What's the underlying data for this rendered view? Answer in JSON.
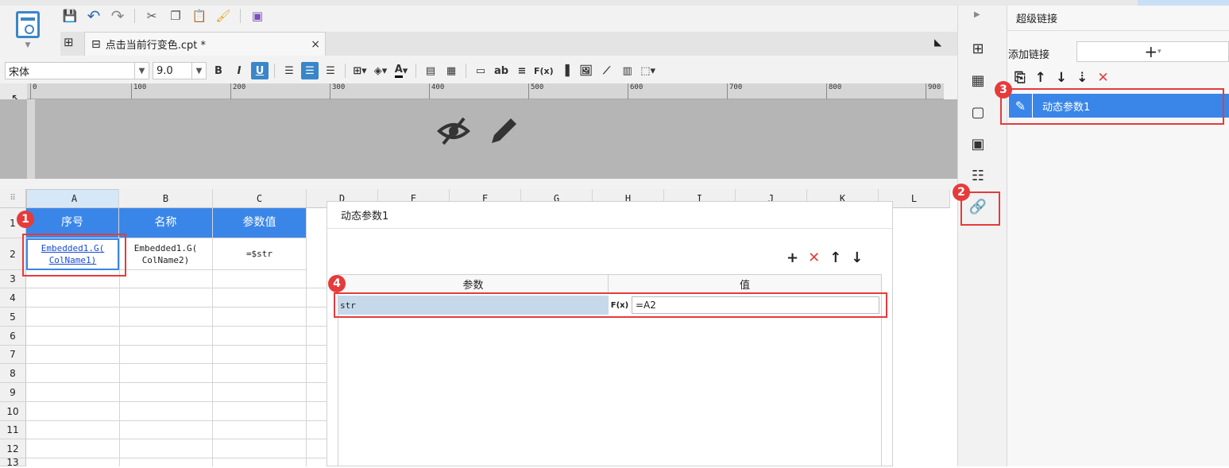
{
  "toolbar": {
    "save": "save-icon",
    "undo": "undo-icon",
    "redo": "redo-icon",
    "cut": "cut-icon",
    "copy": "copy-icon",
    "paste": "paste-icon",
    "brush": "format-painter-icon",
    "template": "template-icon"
  },
  "tab": {
    "name": "点击当前行变色.cpt *",
    "close": "×"
  },
  "format": {
    "font": "宋体",
    "size": "9.0",
    "bold": "B",
    "italic": "I",
    "underline": "U",
    "text_a": "A",
    "ab": "ab",
    "fx": "F(x)"
  },
  "ruler": {
    "ticks": [
      "0",
      "100",
      "200",
      "300",
      "400",
      "500",
      "600",
      "700",
      "800",
      "900"
    ]
  },
  "sheet": {
    "columns": [
      "A",
      "B",
      "C",
      "D",
      "E",
      "F",
      "G",
      "H",
      "I",
      "J",
      "K",
      "L"
    ],
    "rows": [
      "1",
      "2",
      "3",
      "4",
      "5",
      "6",
      "7",
      "8",
      "9",
      "10",
      "11",
      "12",
      "13"
    ],
    "header_row": [
      "序号",
      "名称",
      "参数值"
    ],
    "data_row": {
      "a": "Embedded1.G(\nColName1)",
      "b": "Embedded1.G(\nColName2)",
      "c": "=$str"
    }
  },
  "dialog": {
    "title": "动态参数1",
    "col_param": "参数",
    "col_value": "值",
    "param_name": "str",
    "param_value": "=A2",
    "fx": "F(x)"
  },
  "right_panel": {
    "title": "超级链接",
    "add_label": "添加链接",
    "add_button": "+",
    "item": "动态参数1"
  },
  "badges": [
    "1",
    "2",
    "3",
    "4"
  ],
  "colors": {
    "accent": "#3a86e8",
    "highlight": "#e63b3b",
    "param_bg": "#c5d9ea"
  }
}
